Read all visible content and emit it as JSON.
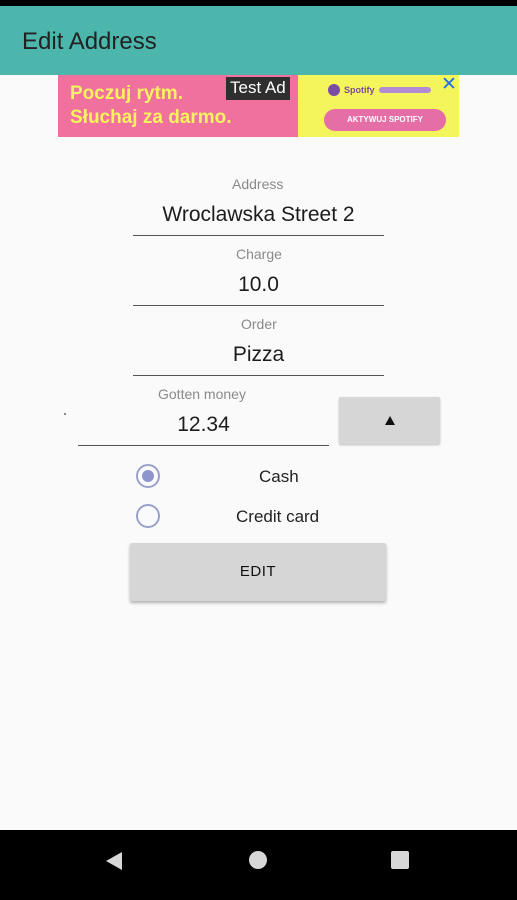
{
  "app_bar": {
    "title": "Edit Address",
    "color": "#4db6ac"
  },
  "ad": {
    "headline_line1": "Poczuj rytm.",
    "headline_line2": "Słuchaj za darmo.",
    "test_label": "Test Ad",
    "brand": "Spotify",
    "cta": "AKTYWUJ SPOTIFY",
    "close_icon": "close-icon"
  },
  "form": {
    "address": {
      "label": "Address",
      "value": "Wroclawska Street 2"
    },
    "charge": {
      "label": "Charge",
      "value": "10.0"
    },
    "order": {
      "label": "Order",
      "value": "Pizza"
    },
    "gotten_money": {
      "label": "Gotten money",
      "value": "12.34"
    },
    "stepper_icon": "arrow-up-icon",
    "payment_options": [
      {
        "label": "Cash",
        "selected": true
      },
      {
        "label": "Credit card",
        "selected": false
      }
    ],
    "submit_label": "EDIT"
  },
  "nav_bar": {
    "icons": [
      "back-icon",
      "home-icon",
      "recents-icon"
    ]
  }
}
